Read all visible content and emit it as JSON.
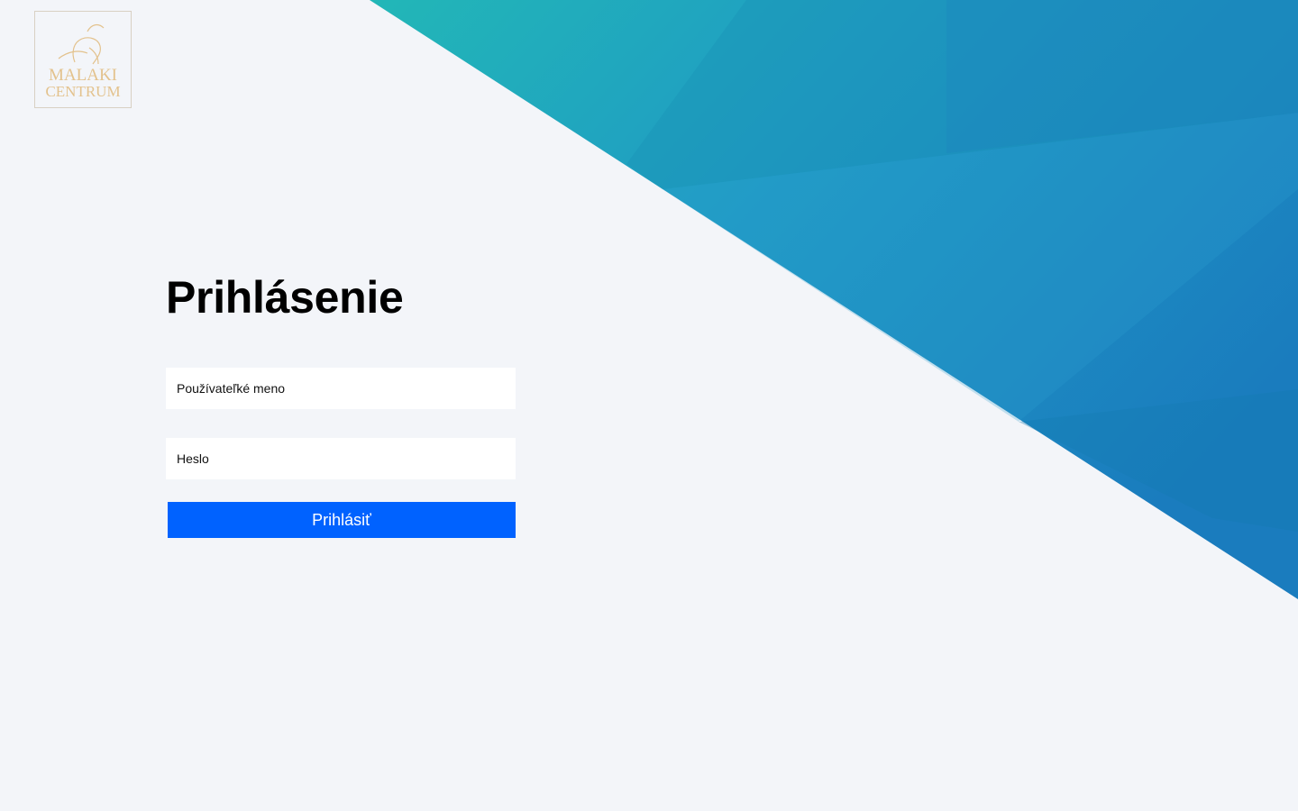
{
  "logo": {
    "line1": "MALAKI",
    "line2": "CENTRUM",
    "color": "#e3c28d"
  },
  "login": {
    "title": "Prihlásenie",
    "username_placeholder": "Používateľké meno",
    "password_placeholder": "Heslo",
    "submit_label": "Prihlásiť"
  },
  "colors": {
    "background": "#f3f5f9",
    "accent_button": "#0062ff",
    "hero_gradient_start": "#22b5b8",
    "hero_gradient_end": "#1a7dbf"
  }
}
